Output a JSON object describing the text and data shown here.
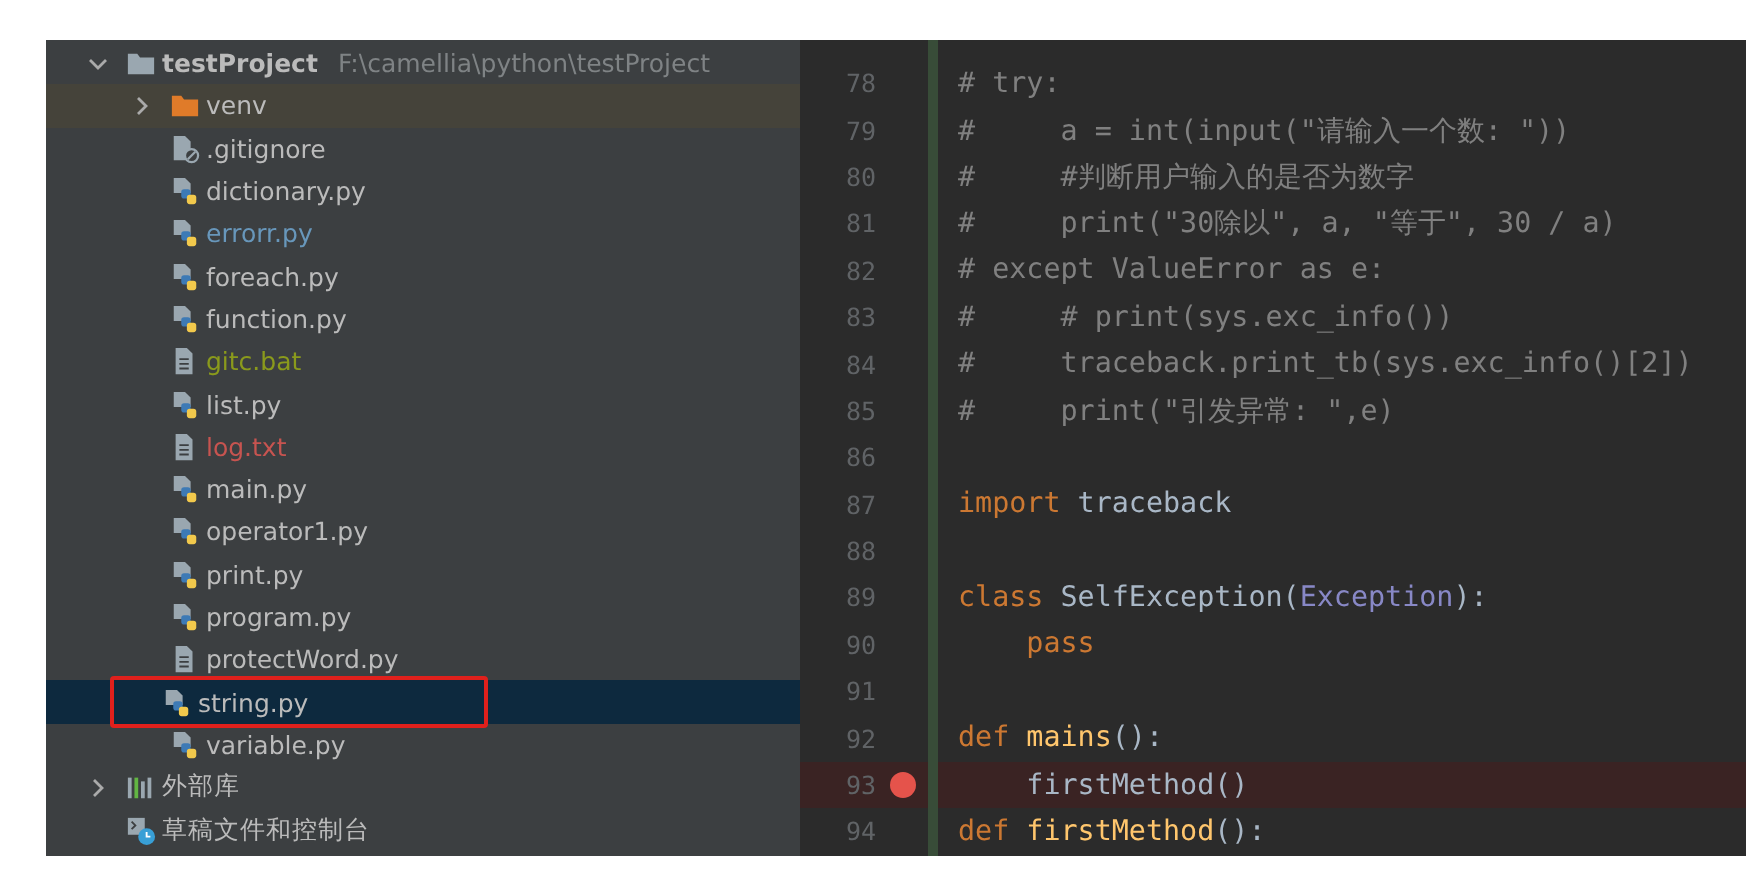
{
  "project_tree": {
    "items": [
      {
        "kind": "project",
        "label": "testProject",
        "path": "F:\\camellia\\python\\testProject",
        "expanded": true,
        "selected": false,
        "highlighted": false,
        "color": "#bbbbbb",
        "children": [
          {
            "kind": "excluded-folder",
            "label": "venv",
            "expanded": false,
            "selected": false,
            "highlighted": false,
            "color": "#bbbbbb"
          },
          {
            "kind": "gitignore",
            "label": ".gitignore",
            "selected": false,
            "highlighted": false,
            "color": "#bbbbbb"
          },
          {
            "kind": "python",
            "label": "dictionary.py",
            "selected": false,
            "highlighted": false,
            "color": "#bbbbbb"
          },
          {
            "kind": "python",
            "label": "errorr.py",
            "selected": false,
            "highlighted": false,
            "color": "#6897bb"
          },
          {
            "kind": "python",
            "label": "foreach.py",
            "selected": false,
            "highlighted": false,
            "color": "#bbbbbb"
          },
          {
            "kind": "python",
            "label": "function.py",
            "selected": false,
            "highlighted": false,
            "color": "#bbbbbb"
          },
          {
            "kind": "text",
            "label": "gitc.bat",
            "selected": false,
            "highlighted": false,
            "color": "#8a9a1c"
          },
          {
            "kind": "python",
            "label": "list.py",
            "selected": false,
            "highlighted": false,
            "color": "#bbbbbb"
          },
          {
            "kind": "text",
            "label": "log.txt",
            "selected": false,
            "highlighted": false,
            "color": "#c75450"
          },
          {
            "kind": "python",
            "label": "main.py",
            "selected": false,
            "highlighted": false,
            "color": "#bbbbbb"
          },
          {
            "kind": "python",
            "label": "operator1.py",
            "selected": false,
            "highlighted": false,
            "color": "#bbbbbb"
          },
          {
            "kind": "python",
            "label": "print.py",
            "selected": false,
            "highlighted": false,
            "color": "#bbbbbb"
          },
          {
            "kind": "python",
            "label": "program.py",
            "selected": false,
            "highlighted": false,
            "color": "#bbbbbb"
          },
          {
            "kind": "text",
            "label": "protectWord.py",
            "selected": false,
            "highlighted": false,
            "color": "#bbbbbb"
          },
          {
            "kind": "python",
            "label": "string.py",
            "selected": true,
            "highlighted": true,
            "color": "#bbbbbb"
          },
          {
            "kind": "python",
            "label": "variable.py",
            "selected": false,
            "highlighted": false,
            "color": "#bbbbbb"
          }
        ]
      },
      {
        "kind": "library",
        "label": "外部库",
        "expanded": false,
        "selected": false,
        "highlighted": false,
        "color": "#bbbbbb"
      },
      {
        "kind": "scratch",
        "label": "草稿文件和控制台",
        "selected": false,
        "highlighted": false,
        "color": "#bbbbbb"
      }
    ]
  },
  "editor": {
    "lines": [
      {
        "number": "78",
        "breakpoint": false,
        "tokens": [
          {
            "kind": "comment",
            "text": "# try:"
          }
        ]
      },
      {
        "number": "79",
        "breakpoint": false,
        "tokens": [
          {
            "kind": "comment",
            "text": "#     a = int(input(\"请输入一个数: \"))"
          }
        ]
      },
      {
        "number": "80",
        "breakpoint": false,
        "tokens": [
          {
            "kind": "comment",
            "text": "#     #判断用户输入的是否为数字"
          }
        ]
      },
      {
        "number": "81",
        "breakpoint": false,
        "tokens": [
          {
            "kind": "comment",
            "text": "#     print(\"30除以\", a, \"等于\", 30 / a)"
          }
        ]
      },
      {
        "number": "82",
        "breakpoint": false,
        "tokens": [
          {
            "kind": "comment",
            "text": "# except ValueError as e:"
          }
        ]
      },
      {
        "number": "83",
        "breakpoint": false,
        "tokens": [
          {
            "kind": "comment",
            "text": "#     # print(sys.exc_info())"
          }
        ]
      },
      {
        "number": "84",
        "breakpoint": false,
        "tokens": [
          {
            "kind": "comment",
            "text": "#     traceback.print_tb(sys.exc_info()[2])"
          }
        ]
      },
      {
        "number": "85",
        "breakpoint": false,
        "tokens": [
          {
            "kind": "comment",
            "text": "#     print(\"引发异常: \",e)"
          }
        ]
      },
      {
        "number": "86",
        "breakpoint": false
      },
      {
        "number": "87",
        "breakpoint": false,
        "tokens": [
          {
            "kind": "keyword",
            "text": "import"
          },
          {
            "kind": "plain",
            "text": " traceback"
          }
        ]
      },
      {
        "number": "88",
        "breakpoint": false
      },
      {
        "number": "89",
        "breakpoint": false,
        "tokens": [
          {
            "kind": "keyword",
            "text": "class"
          },
          {
            "kind": "plain",
            "text": " SelfException("
          },
          {
            "kind": "builtin",
            "text": "Exception"
          },
          {
            "kind": "plain",
            "text": "):"
          }
        ]
      },
      {
        "number": "90",
        "breakpoint": false,
        "tokens": [
          {
            "kind": "keyword",
            "text": "    pass"
          }
        ]
      },
      {
        "number": "91",
        "breakpoint": false
      },
      {
        "number": "92",
        "breakpoint": false,
        "tokens": [
          {
            "kind": "keyword",
            "text": "def"
          },
          {
            "kind": "function",
            "text": " mains"
          },
          {
            "kind": "plain",
            "text": "():"
          }
        ]
      },
      {
        "number": "93",
        "breakpoint": true,
        "tokens": [
          {
            "kind": "plain",
            "text": "    firstMethod()"
          }
        ]
      },
      {
        "number": "94",
        "breakpoint": false,
        "tokens": [
          {
            "kind": "keyword",
            "text": "def"
          },
          {
            "kind": "function",
            "text": " firstMethod"
          },
          {
            "kind": "plain",
            "text": "():"
          }
        ]
      }
    ]
  }
}
